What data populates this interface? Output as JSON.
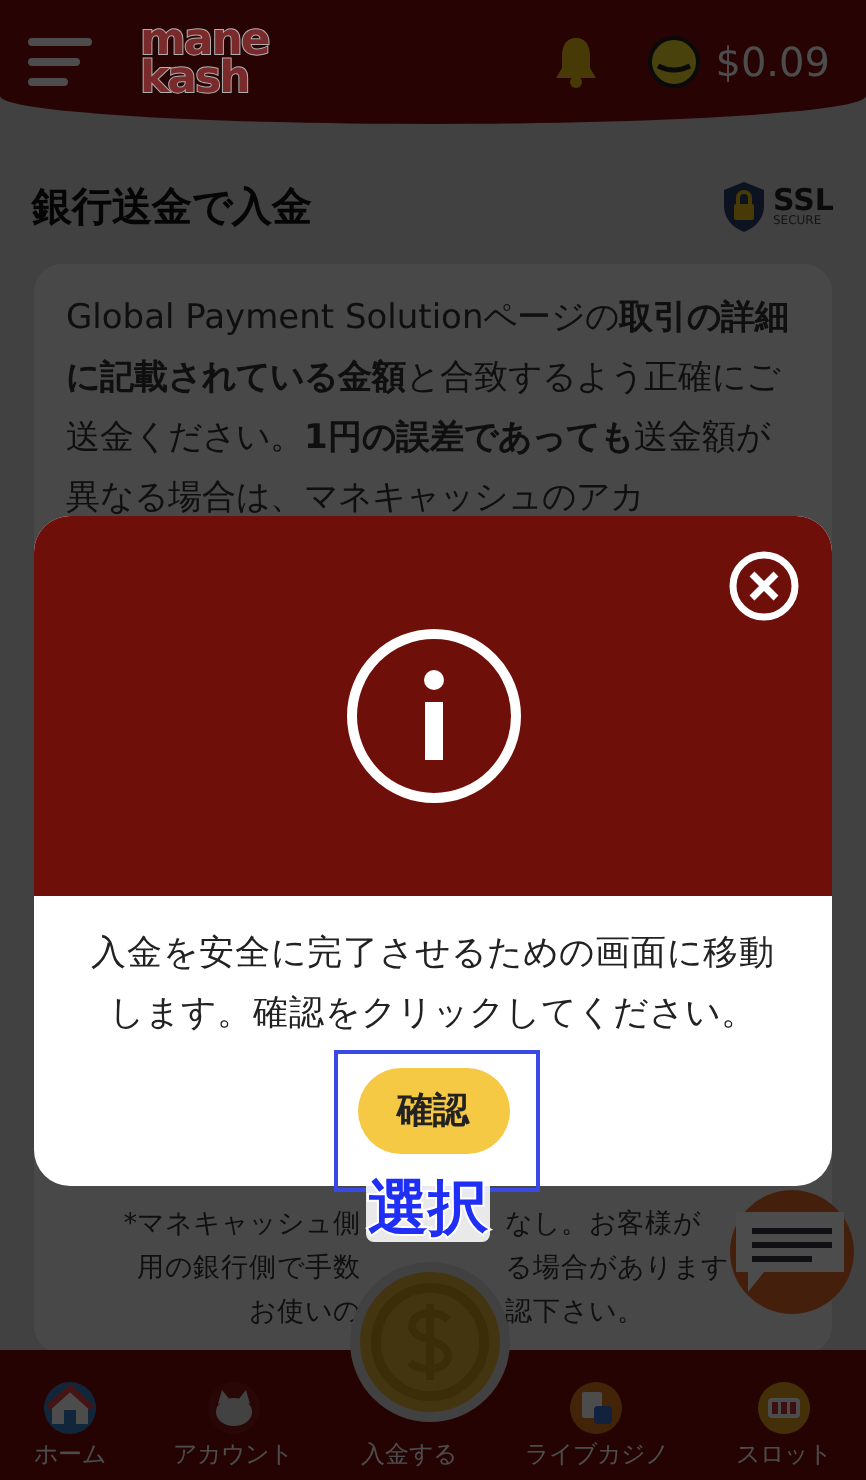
{
  "header": {
    "logo": [
      "mane",
      "kash"
    ],
    "balance": "$0.09"
  },
  "page_title": "銀行送金で入金",
  "ssl_badge": {
    "title": "SSL",
    "subtitle": "SECURE"
  },
  "notice": {
    "text": "Global Payment Solutionページの**取引の詳細に記載されている金額**と合致するよう正確にご送金ください。**1円の誤差であっても**送金額が異なる場合は、マネキャッシュのアカ"
  },
  "note_lines": [
    [
      "*マネキャッシュ側",
      "なし。お客様が"
    ],
    [
      "用の銀行側で手数",
      "る場合があります"
    ],
    [
      "お使いの",
      "認下さい。"
    ]
  ],
  "modal": {
    "message": "入金を安全に完了させるための画面に移動します。確認をクリックしてください。",
    "confirm_button": "確認",
    "annotation": "選択"
  },
  "bottom_nav": [
    {
      "label": "ホーム",
      "kind": "home"
    },
    {
      "label": "アカウント",
      "kind": "account"
    },
    {
      "label": "入金する",
      "kind": "deposit"
    },
    {
      "label": "ライブカジノ",
      "kind": "casino"
    },
    {
      "label": "スロット",
      "kind": "slot"
    }
  ]
}
